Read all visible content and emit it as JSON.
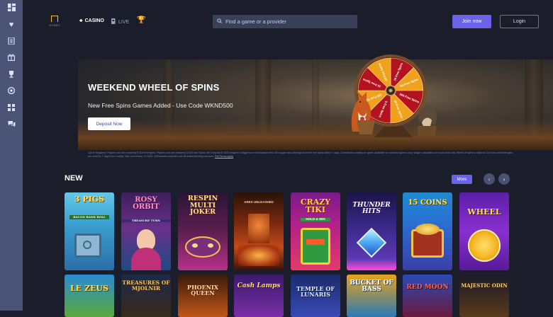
{
  "sidebar": {
    "icons": [
      "grid-icon",
      "heart-icon",
      "list-icon",
      "gift-icon",
      "trophy-icon",
      "chip-icon",
      "apps-icon",
      "chat-icon"
    ]
  },
  "header": {
    "logo_text": "HOBBY",
    "nav_casino": "CASINO",
    "nav_live": "LIVE",
    "search_placeholder": "Find a game or a provider",
    "join_label": "Join now",
    "login_label": "Login"
  },
  "hero": {
    "title": "WEEKEND WHEEL OF SPINS",
    "subtitle": "New Free Spins Games Added - Use Code WKND500",
    "cta_label": "Deposit Now",
    "wheel_segments": [
      "10 Free Spins",
      "50 Free Spins",
      "500 Free Spins",
      "25 Free Spins",
      "5 Free Spins",
      "100 Free Spins",
      "15 Free Spins",
      "20 Free Spins"
    ]
  },
  "terms": {
    "text": "Opt-in Required. Players can win randomly 5-500 free spins. Players can win randomly 5-500 free Spins. Min Deposit $ CA20 required. Wager from real balance first. 50x wager any winnings from the free spins within 7 days. Contribution varies per game. Available on selected games only. Wager calculated on bonus bets only. Wheel of spins is valid for 24 hours and free spins are valid for 7 days from receipt. Max conversion: $ CA20. Withdrawal requests void all active/pending bonuses.",
    "link": "Full Terms apply"
  },
  "section": {
    "title": "NEW",
    "more_label": "More"
  },
  "games_row1": [
    {
      "title": "3 PIGS",
      "subtitle": "BACON BANK ROLL"
    },
    {
      "title": "ROSY ORBIT",
      "subtitle": "TREASURE TURN"
    },
    {
      "title": "RESPIN MULTI JOKER",
      "subtitle": ""
    },
    {
      "title": "ARES UNLEASHED",
      "subtitle": ""
    },
    {
      "title": "CRAZY TIKI",
      "subtitle": "HOLD & WIN"
    },
    {
      "title": "THUNDER HITS",
      "subtitle": ""
    },
    {
      "title": "15 COINS",
      "subtitle": ""
    },
    {
      "title": "WHEEL",
      "subtitle": ""
    }
  ],
  "games_row2": [
    {
      "title": "LE ZEUS"
    },
    {
      "title": "TREASURES OF MJOLNIR"
    },
    {
      "title": "PHOENIX QUEEN"
    },
    {
      "title": "Cash Lamps"
    },
    {
      "title": "TEMPLE OF LUNARIS"
    },
    {
      "title": "BUCKET OF BASS"
    },
    {
      "title": "RED MOON"
    },
    {
      "title": "MAJESTIC ODIN"
    }
  ]
}
